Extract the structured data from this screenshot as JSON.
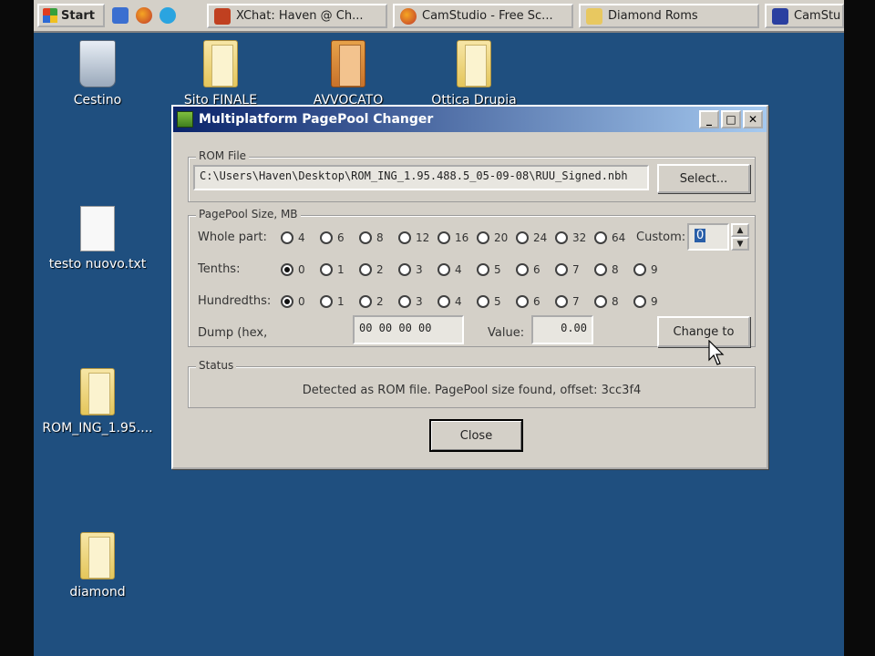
{
  "taskbar": {
    "start_label": "Start",
    "quicklaunch": [
      "outlook-icon",
      "firefox-icon",
      "skype-icon"
    ],
    "tasks": [
      {
        "label": "XChat: Haven @ Ch...",
        "icon": "xchat-icon"
      },
      {
        "label": "CamStudio - Free Sc...",
        "icon": "firefox-icon"
      },
      {
        "label": "Diamond Roms",
        "icon": "folder-icon"
      },
      {
        "label": "CamStu",
        "icon": "camstudio-icon"
      }
    ]
  },
  "desktop": {
    "icons": [
      {
        "label": "Cestino",
        "icon": "recycle-bin-icon"
      },
      {
        "label": "Sito FINALE",
        "icon": "folder-icon"
      },
      {
        "label": "AVVOCATO",
        "icon": "folder-icon"
      },
      {
        "label": "Ottica Drupia",
        "icon": "folder-icon"
      },
      {
        "label": "testo nuovo.txt",
        "icon": "text-file-icon"
      },
      {
        "label": "ROM_ING_1.95....",
        "icon": "folder-icon"
      },
      {
        "label": "diamond",
        "icon": "folder-icon"
      }
    ]
  },
  "dialog": {
    "title": "Multiplatform PagePool Changer",
    "rom_group_label": "ROM File",
    "rom_path": "C:\\Users\\Haven\\Desktop\\ROM_ING_1.95.488.5_05-09-08\\RUU_Signed.nbh",
    "select_button": "Select...",
    "pagepool_group_label": "PagePool Size, MB",
    "whole_label": "Whole part:",
    "whole_options": [
      "4",
      "6",
      "8",
      "12",
      "16",
      "20",
      "24",
      "32",
      "64"
    ],
    "custom_label": "Custom:",
    "custom_value": "0",
    "tenths_label": "Tenths:",
    "tenths_options": [
      "0",
      "1",
      "2",
      "3",
      "4",
      "5",
      "6",
      "7",
      "8",
      "9"
    ],
    "tenths_selected": 0,
    "hundredths_label": "Hundredths:",
    "hundredths_options": [
      "0",
      "1",
      "2",
      "3",
      "4",
      "5",
      "6",
      "7",
      "8",
      "9"
    ],
    "hundredths_selected": 0,
    "dump_label": "Dump (hex,",
    "dump_value": "00 00 00 00",
    "value_label": "Value:",
    "value_value": "0.00",
    "change_button": "Change to",
    "status_group_label": "Status",
    "status_text": "Detected as ROM file. PagePool size found, offset: 3cc3f4",
    "close_button": "Close"
  }
}
